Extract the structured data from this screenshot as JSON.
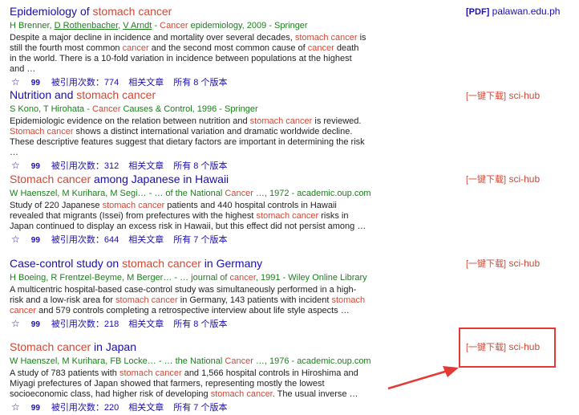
{
  "results": [
    {
      "title": [
        {
          "t": "Epidemiology of "
        },
        {
          "t": "stomach cancer",
          "hl": true
        }
      ],
      "meta": [
        {
          "t": "H Brenner, "
        },
        {
          "t": "D Rothenbacher",
          "u": true
        },
        {
          "t": ", "
        },
        {
          "t": "V Arndt",
          "u": true
        },
        {
          "t": " - "
        },
        {
          "t": "Cancer",
          "hl": true
        },
        {
          "t": " epidemiology, 2009 - Springer"
        }
      ],
      "snippet": [
        {
          "t": "Despite a major decline in incidence and mortality over several decades, "
        },
        {
          "t": "stomach cancer",
          "hl": true
        },
        {
          "t": " is still the fourth most common "
        },
        {
          "t": "cancer",
          "hl": true
        },
        {
          "t": " and the second most common cause of "
        },
        {
          "t": "cancer",
          "hl": true
        },
        {
          "t": " death in the world. There is a 10-fold variation in incidence between populations at the highest and …"
        }
      ],
      "cited": "被引用次数：774",
      "related": "相关文章",
      "versions": "所有 8 个版本",
      "side_tag": "[PDF]",
      "side_site": "palawan.edu.ph"
    },
    {
      "title": [
        {
          "t": "Nutrition and "
        },
        {
          "t": "stomach cancer",
          "hl": true
        }
      ],
      "meta": [
        {
          "t": "S Kono, T Hirohata - "
        },
        {
          "t": "Cancer",
          "hl": true
        },
        {
          "t": " Causes & Control, 1996 - Springer"
        }
      ],
      "snippet": [
        {
          "t": "Epidemiologic evidence on the relation between nutrition and "
        },
        {
          "t": "stomach cancer",
          "hl": true
        },
        {
          "t": " is reviewed. "
        },
        {
          "t": "Stomach cancer",
          "hl": true
        },
        {
          "t": " shows a distinct international variation and dramatic worldwide decline. These descriptive features suggest that dietary factors are important in determining the risk …"
        }
      ],
      "cited": "被引用次数：312",
      "related": "相关文章",
      "versions": "所有 8 个版本",
      "side_tag": "[一键下载]",
      "side_site": "sci-hub"
    },
    {
      "title": [
        {
          "t": "Stomach cancer",
          "hl": true
        },
        {
          "t": " among Japanese in Hawaii"
        }
      ],
      "meta": [
        {
          "t": "W Haenszel, M Kurihara, M Segi… - … of the National "
        },
        {
          "t": "Cancer",
          "hl": true
        },
        {
          "t": " …, 1972 - academic.oup.com"
        }
      ],
      "snippet": [
        {
          "t": "Study of 220 Japanese "
        },
        {
          "t": "stomach cancer",
          "hl": true
        },
        {
          "t": " patients and 440 hospital controls in Hawaii revealed that migrants (Issei) from prefectures with the highest "
        },
        {
          "t": "stomach cancer",
          "hl": true
        },
        {
          "t": " risks in Japan continued to display an excess risk in Hawaii, but this effect did not persist among …"
        }
      ],
      "cited": "被引用次数：644",
      "related": "相关文章",
      "versions": "所有 7 个版本",
      "side_tag": "[一键下载]",
      "side_site": "sci-hub"
    },
    {
      "title": [
        {
          "t": "Case-control study on "
        },
        {
          "t": "stomach cancer",
          "hl": true
        },
        {
          "t": " in Germany"
        }
      ],
      "meta": [
        {
          "t": "H Boeing, R Frentzel-Beyme, M Berger… - … journal of "
        },
        {
          "t": "cancer",
          "hl": true
        },
        {
          "t": ", 1991 - Wiley Online Library"
        }
      ],
      "snippet": [
        {
          "t": "A multicentric hospital-based case-control study was simultaneously performed in a high-risk and a low-risk area for "
        },
        {
          "t": "stomach cancer",
          "hl": true
        },
        {
          "t": " in Germany, 143 patients with incident "
        },
        {
          "t": "stomach cancer",
          "hl": true
        },
        {
          "t": " and 579 controls completing a retrospective interview about life style aspects …"
        }
      ],
      "cited": "被引用次数：218",
      "related": "相关文章",
      "versions": "所有 8 个版本",
      "side_tag": "[一键下载]",
      "side_site": "sci-hub"
    },
    {
      "title": [
        {
          "t": "Stomach cancer",
          "hl": true
        },
        {
          "t": " in Japan"
        }
      ],
      "meta": [
        {
          "t": "W Haenszel, M Kurihara, FB Locke… - … the National "
        },
        {
          "t": "Cancer",
          "hl": true
        },
        {
          "t": " …, 1976 - academic.oup.com"
        }
      ],
      "snippet": [
        {
          "t": "A study of 783 patients with "
        },
        {
          "t": "stomach cancer",
          "hl": true
        },
        {
          "t": " and 1,566 hospital controls in Hiroshima and Miyagi prefectures of Japan showed that farmers, representing mostly the lowest socioeconomic class, had higher risk of developing "
        },
        {
          "t": "stomach cancer",
          "hl": true
        },
        {
          "t": ". The usual inverse …"
        }
      ],
      "cited": "被引用次数：220",
      "related": "相关文章",
      "versions": "所有 7 个版本",
      "side_tag": "[一键下载]",
      "side_site": "sci-hub"
    }
  ],
  "icons": {
    "save": "star-icon",
    "cite": "quote-icon",
    "arrow": "red-arrow-annotation"
  },
  "colors": {
    "link": "#1a0dab",
    "highlight": "#d14836",
    "source": "#1a7f1a",
    "annotation": "#e53935"
  }
}
